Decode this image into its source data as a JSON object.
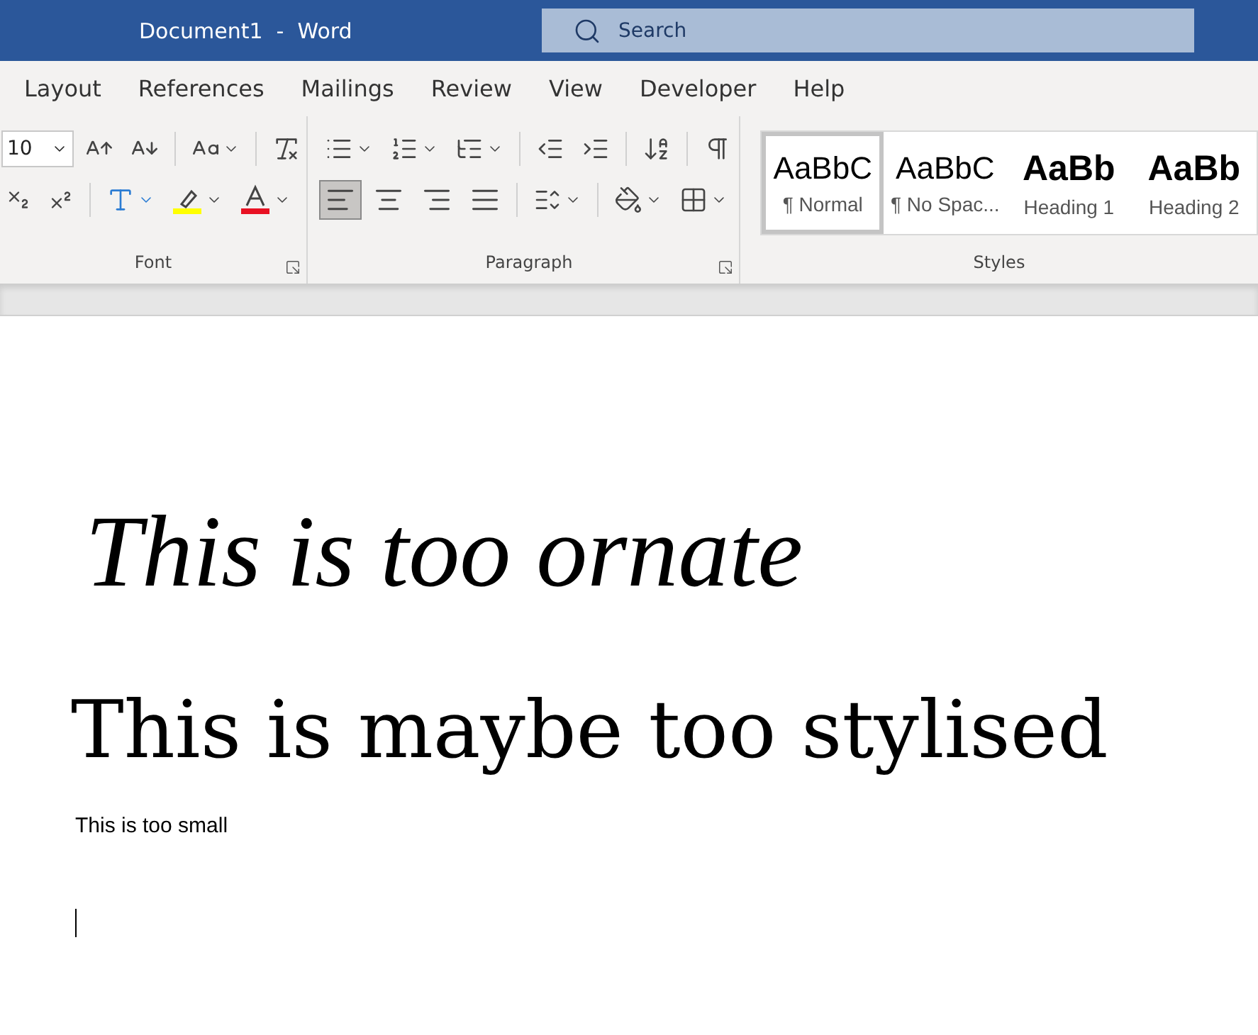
{
  "window": {
    "title": "Document1  -  Word"
  },
  "search": {
    "placeholder": "Search"
  },
  "tabs": [
    {
      "label": "Layout"
    },
    {
      "label": "References"
    },
    {
      "label": "Mailings"
    },
    {
      "label": "Review"
    },
    {
      "label": "View"
    },
    {
      "label": "Developer"
    },
    {
      "label": "Help"
    }
  ],
  "font_group": {
    "label": "Font",
    "font_size": "10"
  },
  "paragraph_group": {
    "label": "Paragraph",
    "alignments": [
      {
        "kind": "left",
        "selected": true
      },
      {
        "kind": "center",
        "selected": false
      },
      {
        "kind": "right",
        "selected": false
      },
      {
        "kind": "justify",
        "selected": false
      }
    ]
  },
  "styles_group": {
    "label": "Styles",
    "styles": [
      {
        "kind": "normal",
        "sample": "AaBbC",
        "name": "¶ Normal",
        "selected": true
      },
      {
        "kind": "normal",
        "sample": "AaBbC",
        "name": "¶ No Spac...",
        "selected": false
      },
      {
        "kind": "heading",
        "sample": "AaBb",
        "name": "Heading 1",
        "selected": false
      },
      {
        "kind": "heading",
        "sample": "AaBb",
        "name": "Heading 2",
        "selected": false
      }
    ]
  },
  "document": {
    "paragraphs": [
      {
        "kind": "ornate",
        "text": "This is too ornate"
      },
      {
        "kind": "stylised",
        "text": "This is maybe too stylised"
      },
      {
        "kind": "small",
        "text": "This is too small"
      }
    ],
    "cursor": true
  }
}
